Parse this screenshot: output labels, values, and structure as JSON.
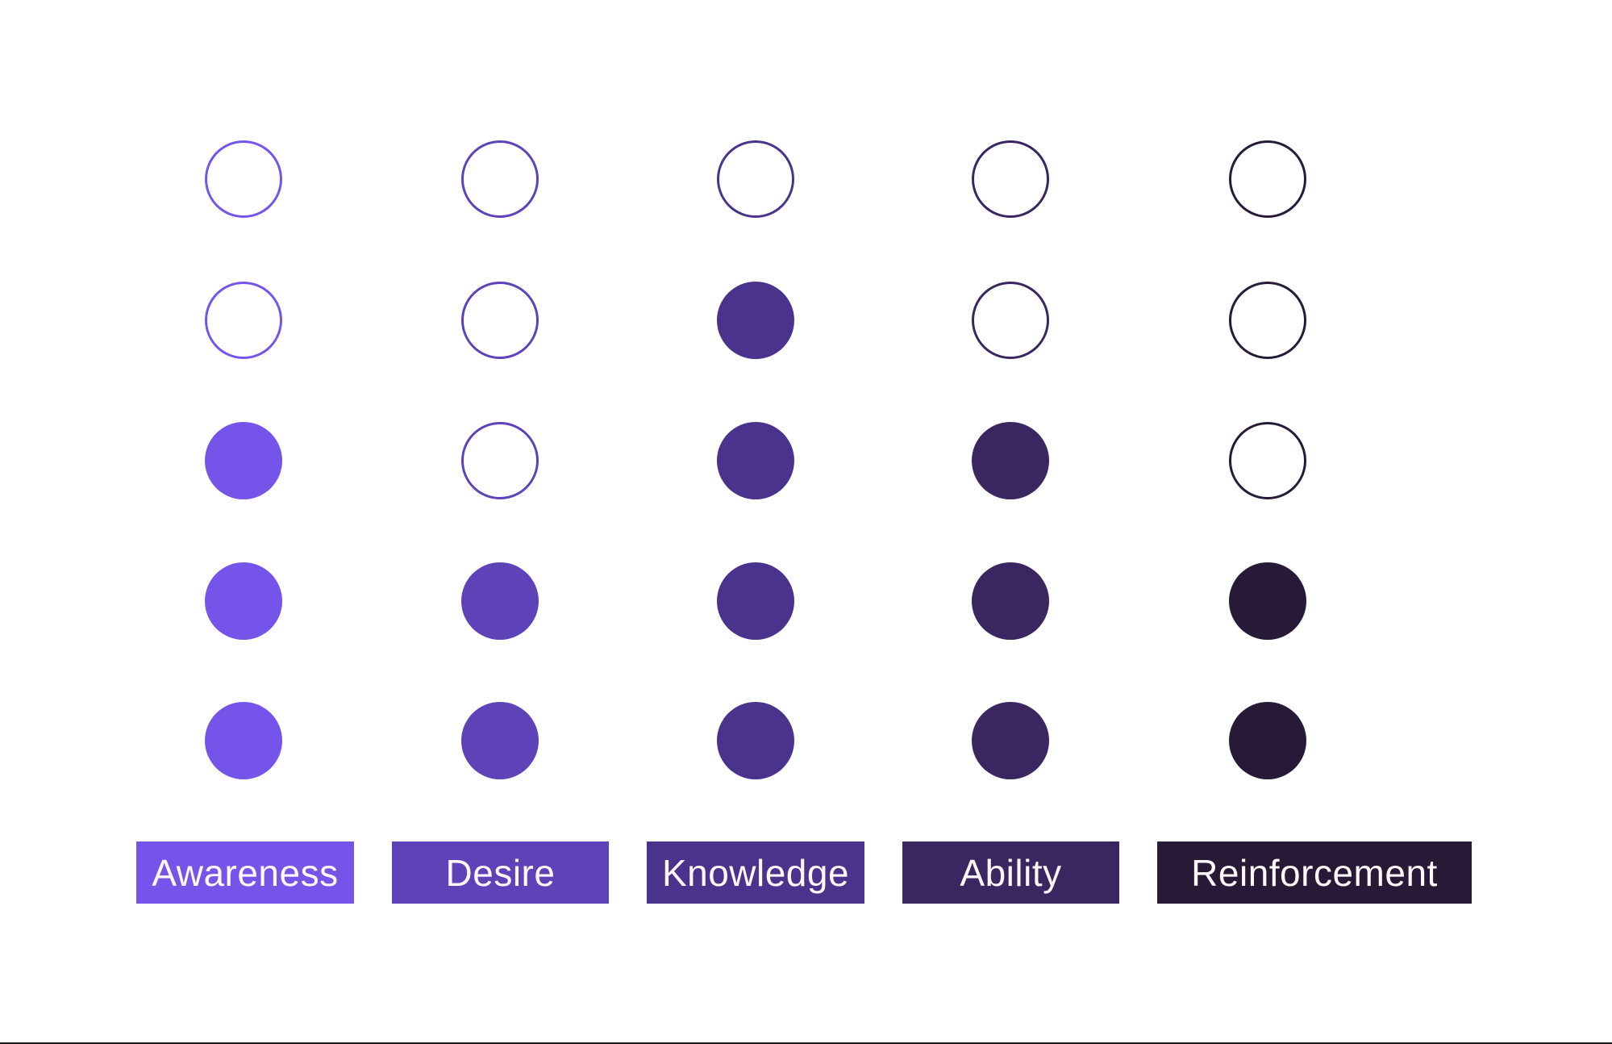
{
  "diagram": {
    "title": "",
    "rows": 5,
    "stages": [
      {
        "label": "Awareness",
        "color": "#7554EA",
        "filled": 3
      },
      {
        "label": "Desire",
        "color": "#5E42B8",
        "filled": 2
      },
      {
        "label": "Knowledge",
        "color": "#4A338C",
        "filled": 4
      },
      {
        "label": "Ability",
        "color": "#3A2660",
        "filled": 3
      },
      {
        "label": "Reinforcement",
        "color": "#271A37",
        "filled": 2
      }
    ]
  }
}
